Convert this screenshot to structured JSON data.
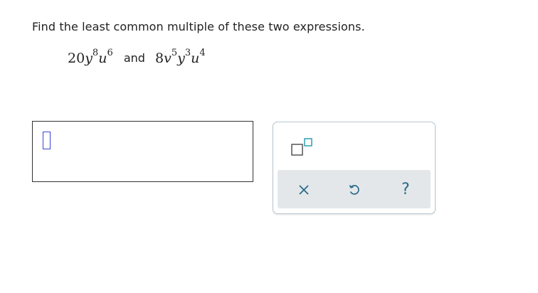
{
  "question": {
    "prompt": "Find the least common multiple of these two expressions.",
    "expr1": {
      "coef": "20",
      "v1": "y",
      "e1": "8",
      "v2": "u",
      "e2": "6"
    },
    "connector": "and",
    "expr2": {
      "coef": "8",
      "v1": "v",
      "e1": "5",
      "v2": "y",
      "e2": "3",
      "v3": "u",
      "e3": "4"
    }
  },
  "answer": {
    "value": ""
  },
  "toolbar": {
    "buttons": [
      {
        "name": "exponent",
        "icon": "superscript-box-icon"
      },
      {
        "name": "clear",
        "icon": "close-icon"
      },
      {
        "name": "undo",
        "icon": "undo-icon"
      },
      {
        "name": "help",
        "icon": "help-icon",
        "label": "?"
      }
    ]
  },
  "colors": {
    "text": "#222222",
    "cursor": "#3b46d1",
    "accent_teal": "#2a6a88",
    "icon_teal": "#2b9fb4",
    "panel_border": "#b9c8d2",
    "action_bar": "#e3e7ea"
  }
}
